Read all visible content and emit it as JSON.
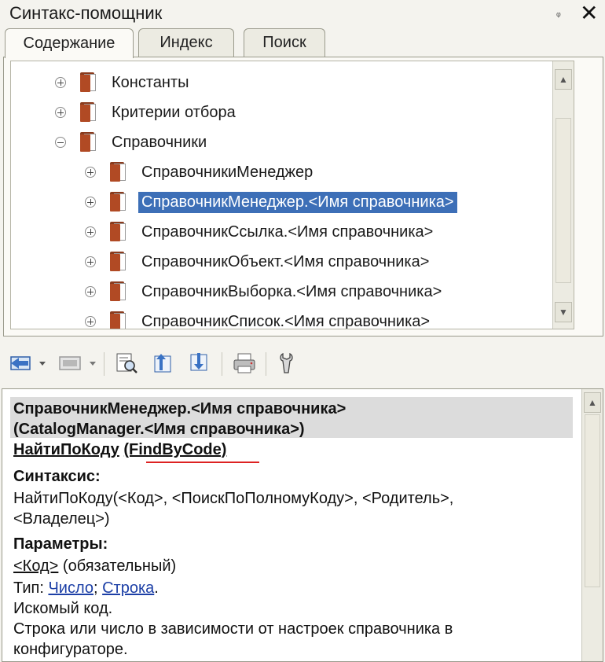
{
  "window": {
    "title": "Синтакс-помощник",
    "pin": "ᵩ",
    "close": "✕"
  },
  "tabs": [
    {
      "label": "Содержание",
      "active": true
    },
    {
      "label": "Индекс",
      "active": false
    },
    {
      "label": "Поиск",
      "active": false
    }
  ],
  "tree": {
    "items": [
      {
        "label": "Константы",
        "level": 0,
        "expander": "plus"
      },
      {
        "label": "Критерии отбора",
        "level": 0,
        "expander": "plus"
      },
      {
        "label": "Справочники",
        "level": 0,
        "expander": "minus"
      },
      {
        "label": "СправочникиМенеджер",
        "level": 1,
        "expander": "plus"
      },
      {
        "label": "СправочникМенеджер.<Имя справочника>",
        "level": 1,
        "expander": "plus",
        "selected": true
      },
      {
        "label": "СправочникСсылка.<Имя справочника>",
        "level": 1,
        "expander": "plus"
      },
      {
        "label": "СправочникОбъект.<Имя справочника>",
        "level": 1,
        "expander": "plus"
      },
      {
        "label": "СправочникВыборка.<Имя справочника>",
        "level": 1,
        "expander": "plus"
      },
      {
        "label": "СправочникСписок.<Имя справочника>",
        "level": 1,
        "expander": "plus"
      }
    ]
  },
  "toolbar": {
    "icons": [
      "back-icon",
      "forward-icon",
      "find-in-text-icon",
      "sync-up-icon",
      "sync-down-icon",
      "print-icon",
      "settings-icon"
    ]
  },
  "description": {
    "header_line1": "СправочникМенеджер.<Имя справочника>",
    "header_line2": "(CatalogManager.<Имя справочника>)",
    "method_ru": "НайтиПоКоду",
    "method_en": "(FindByCode)",
    "syntax_heading": "Синтаксис:",
    "syntax_line1": "НайтиПоКоду(<Код>, <ПоискПоПолномуКоду>, <Родитель>,",
    "syntax_line2": "<Владелец>)",
    "params_heading": "Параметры:",
    "param_name": "<Код>",
    "param_required": " (обязательный)",
    "type_prefix": "Тип: ",
    "type_number": "Число",
    "type_sep": "; ",
    "type_string": "Строка",
    "type_end": ".",
    "desc_line1": "Искомый код.",
    "desc_line2": "Строка или число в зависимости от настроек справочника в",
    "desc_line3": "конфигураторе."
  },
  "colors": {
    "selection": "#3d6fb7",
    "link": "#1c3fa6",
    "highlight_underline": "#dd2222"
  }
}
